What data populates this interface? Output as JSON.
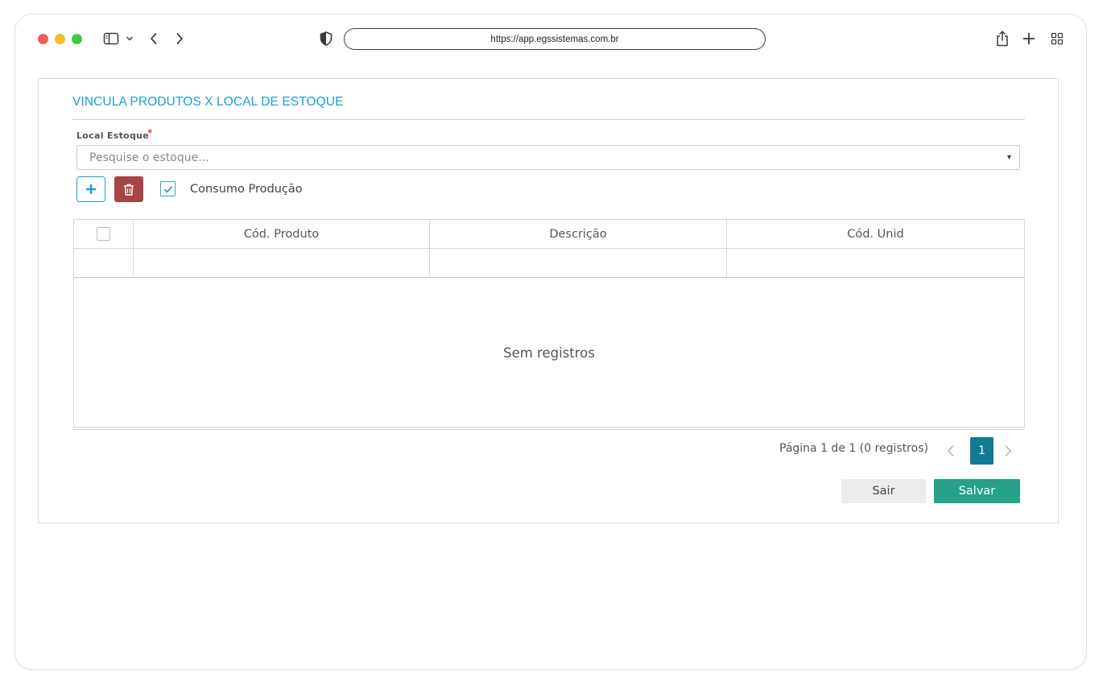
{
  "browser": {
    "url": "https://app.egssistemas.com.br"
  },
  "page": {
    "title": "VINCULA PRODUTOS X LOCAL DE ESTOQUE",
    "local_estoque": {
      "label": "Local Estoque",
      "required_mark": "*",
      "placeholder": "Pesquise o estoque...",
      "caret": "▾"
    },
    "toolbar": {
      "add_icon": "plus-icon",
      "delete_icon": "trash-icon",
      "consumo_checked": true,
      "consumo_label": "Consumo Produção"
    },
    "table": {
      "columns": [
        "Cód. Produto",
        "Descrição",
        "Cód. Unid"
      ],
      "rows": [],
      "empty_message": "Sem registros"
    },
    "pager": {
      "summary": "Página 1 de 1 (0 registros)",
      "current_page": "1"
    },
    "actions": {
      "exit_label": "Sair",
      "save_label": "Salvar"
    }
  },
  "colors": {
    "title": "#1a9fd3",
    "delete_button": "#a74444",
    "active_page": "#137a93",
    "save_button": "#27a187"
  }
}
